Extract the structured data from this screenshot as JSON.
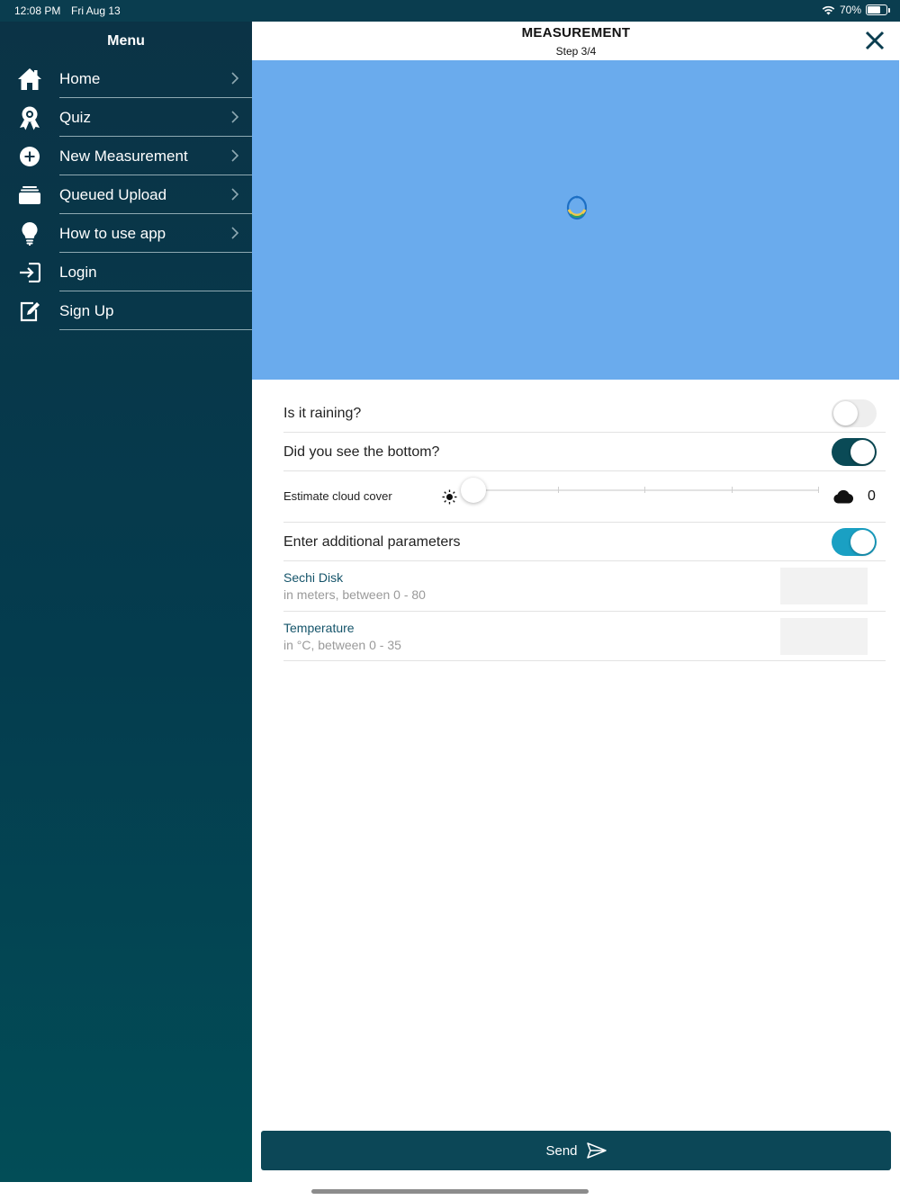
{
  "status_bar": {
    "time": "12:08 PM",
    "date": "Fri Aug 13",
    "battery_text": "70%",
    "battery_level": 0.7
  },
  "sidebar": {
    "title": "Menu",
    "items": [
      {
        "label": "Home",
        "icon": "home-icon",
        "chevron": true
      },
      {
        "label": "Quiz",
        "icon": "award-icon",
        "chevron": true
      },
      {
        "label": "New Measurement",
        "icon": "plus-circle-icon",
        "chevron": true
      },
      {
        "label": "Queued Upload",
        "icon": "stack-icon",
        "chevron": true
      },
      {
        "label": "How to use app",
        "icon": "lightbulb-icon",
        "chevron": true
      },
      {
        "label": "Login",
        "icon": "login-icon",
        "chevron": false
      },
      {
        "label": "Sign Up",
        "icon": "edit-icon",
        "chevron": false
      }
    ]
  },
  "header": {
    "title": "MEASUREMENT",
    "step": "Step 3/4"
  },
  "form": {
    "raining": {
      "label": "Is it raining?",
      "on": false
    },
    "bottom": {
      "label": "Did you see the bottom?",
      "on": true
    },
    "cloud": {
      "label": "Estimate cloud cover",
      "value": "0",
      "slider_fraction": 0
    },
    "additional": {
      "label": "Enter additional parameters",
      "on": true
    },
    "params": [
      {
        "title": "Sechi Disk",
        "hint": "in meters, between 0 - 80",
        "value": ""
      },
      {
        "title": "Temperature",
        "hint": "in °C, between 0 - 35",
        "value": ""
      }
    ]
  },
  "send": {
    "label": "Send"
  },
  "colors": {
    "sidebar_top": "#0b3346",
    "sidebar_bottom": "#024d57",
    "photo_bg": "#6aabed",
    "toggle_dark": "#0a4a56",
    "toggle_teal": "#1aa0c3",
    "send_bg": "#0c4757"
  }
}
